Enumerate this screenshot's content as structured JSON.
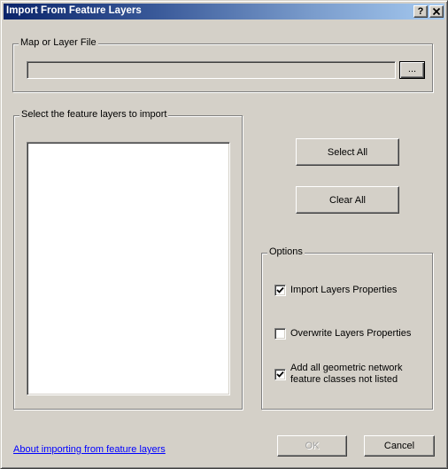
{
  "window": {
    "title": "Import From Feature Layers",
    "help_button": "?",
    "close_button": "✕"
  },
  "map_layer_group": {
    "label": "Map or Layer File",
    "path_value": "",
    "browse_button": "..."
  },
  "feature_layers_group": {
    "label": "Select the feature layers to import",
    "items": []
  },
  "actions": {
    "select_all": "Select All",
    "clear_all": "Clear All"
  },
  "options": {
    "label": "Options",
    "items": [
      {
        "label": "Import Layers Properties",
        "checked": true
      },
      {
        "label": "Overwrite Layers Properties",
        "checked": false
      },
      {
        "label": "Add all geometric network feature classes not listed",
        "label_line1": "Add all geometric network",
        "label_line2": "feature classes not listed",
        "checked": true
      }
    ]
  },
  "footer": {
    "help_link": "About importing from feature layers",
    "ok_button": "OK",
    "ok_enabled": false,
    "cancel_button": "Cancel"
  }
}
